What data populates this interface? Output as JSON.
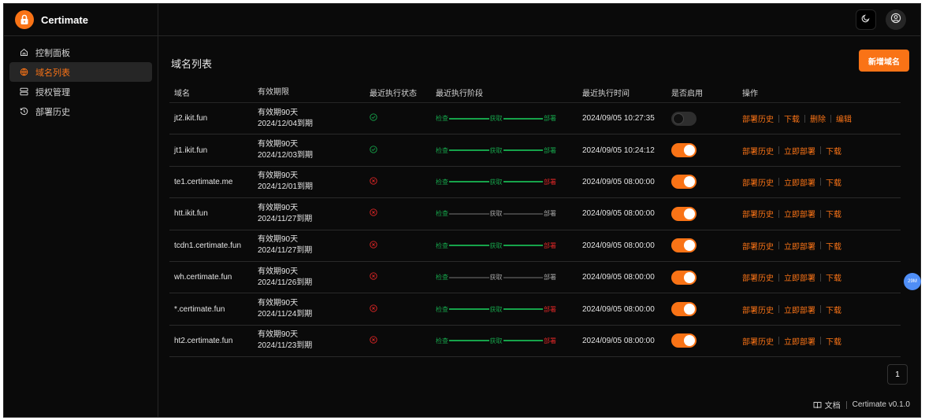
{
  "app": {
    "name": "Certimate",
    "version": "Certimate v0.1.0",
    "docs_label": "文档",
    "accent": "#f97316"
  },
  "sidebar": {
    "items": [
      {
        "label": "控制面板",
        "icon": "home-icon",
        "active": false
      },
      {
        "label": "域名列表",
        "icon": "globe-icon",
        "active": true
      },
      {
        "label": "授权管理",
        "icon": "server-icon",
        "active": false
      },
      {
        "label": "部署历史",
        "icon": "history-icon",
        "active": false
      }
    ]
  },
  "header": {
    "theme_icon": "moon-icon",
    "user_icon": "user-circle-icon"
  },
  "page": {
    "title": "域名列表",
    "add_button": "新增域名"
  },
  "table": {
    "headers": [
      "域名",
      "有效期限",
      "最近执行状态",
      "最近执行阶段",
      "最近执行时间",
      "是否启用",
      "操作"
    ],
    "stage_labels": [
      "检查",
      "获取",
      "部署"
    ],
    "rows": [
      {
        "domain": "jt2.ikit.fun",
        "valid1": "有效期90天",
        "valid2": "2024/12/04到期",
        "status": "success",
        "stage": "deploy-ok",
        "time": "2024/09/05 10:27:35",
        "enabled": false,
        "actions": [
          "部署历史",
          "下载",
          "删除",
          "编辑"
        ]
      },
      {
        "domain": "jt1.ikit.fun",
        "valid1": "有效期90天",
        "valid2": "2024/12/03到期",
        "status": "success",
        "stage": "deploy-ok",
        "time": "2024/09/05 10:24:12",
        "enabled": true,
        "actions": [
          "部署历史",
          "立即部署",
          "下载"
        ]
      },
      {
        "domain": "te1.certimate.me",
        "valid1": "有效期90天",
        "valid2": "2024/12/01到期",
        "status": "failed",
        "stage": "deploy-fail",
        "time": "2024/09/05 08:00:00",
        "enabled": true,
        "actions": [
          "部署历史",
          "立即部署",
          "下载"
        ]
      },
      {
        "domain": "htt.ikit.fun",
        "valid1": "有效期90天",
        "valid2": "2024/11/27到期",
        "status": "failed",
        "stage": "check-only",
        "time": "2024/09/05 08:00:00",
        "enabled": true,
        "actions": [
          "部署历史",
          "立即部署",
          "下载"
        ]
      },
      {
        "domain": "tcdn1.certimate.fun",
        "valid1": "有效期90天",
        "valid2": "2024/11/27到期",
        "status": "failed",
        "stage": "deploy-fail",
        "time": "2024/09/05 08:00:00",
        "enabled": true,
        "actions": [
          "部署历史",
          "立即部署",
          "下载"
        ]
      },
      {
        "domain": "wh.certimate.fun",
        "valid1": "有效期90天",
        "valid2": "2024/11/26到期",
        "status": "failed",
        "stage": "check-only",
        "time": "2024/09/05 08:00:00",
        "enabled": true,
        "actions": [
          "部署历史",
          "立即部署",
          "下载"
        ]
      },
      {
        "domain": "*.certimate.fun",
        "valid1": "有效期90天",
        "valid2": "2024/11/24到期",
        "status": "failed",
        "stage": "deploy-fail",
        "time": "2024/09/05 08:00:00",
        "enabled": true,
        "actions": [
          "部署历史",
          "立即部署",
          "下载"
        ]
      },
      {
        "domain": "ht2.certimate.fun",
        "valid1": "有效期90天",
        "valid2": "2024/11/23到期",
        "status": "failed",
        "stage": "deploy-fail",
        "time": "2024/09/05 08:00:00",
        "enabled": true,
        "actions": [
          "部署历史",
          "立即部署",
          "下载"
        ]
      }
    ]
  },
  "pagination": {
    "current": "1"
  },
  "float_badge": "29M"
}
